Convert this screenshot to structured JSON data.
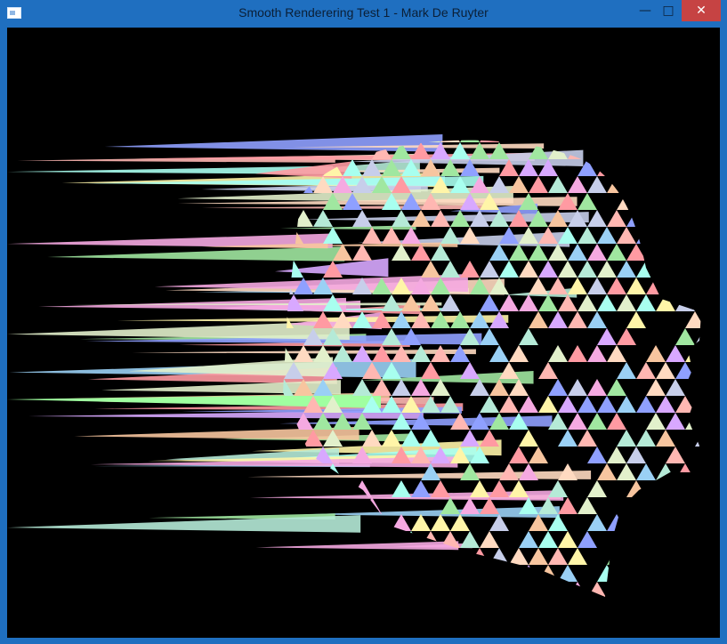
{
  "window": {
    "title": "Smooth Renderering Test 1 - Mark De Ruyter",
    "controls": {
      "minimize_glyph": "—",
      "maximize_glyph": "□",
      "close_glyph": "✕"
    }
  },
  "colors": {
    "titlebar": "#1f6fc0",
    "close": "#c64343",
    "background": "#000000",
    "palette": [
      "#ff9aa2",
      "#ffb7b2",
      "#ffdac1",
      "#e2f0cb",
      "#b5ead7",
      "#c7ceea",
      "#a0e7a0",
      "#9ad0f5",
      "#f5a9e1",
      "#d8a8ff",
      "#fff5a8",
      "#8fa0ff",
      "#f7c59f",
      "#a8ffef"
    ]
  }
}
